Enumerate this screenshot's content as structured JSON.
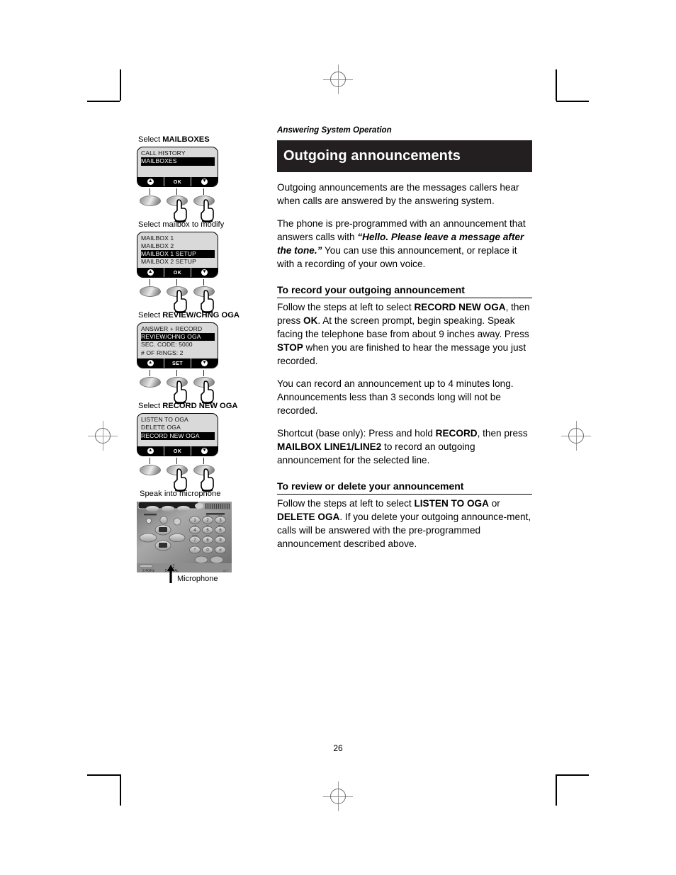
{
  "page": {
    "number": "26",
    "running_head": "Answering System Operation"
  },
  "banner": {
    "title": "Outgoing announcements"
  },
  "intro": [
    "Outgoing announcements are the messages callers hear when calls are answered by the answering system."
  ],
  "para2": {
    "before": "The phone is pre-programmed with an announcement that answers calls with ",
    "quote": "“Hello. Please leave a message after the tone.”",
    "after": " You can use this announcement, or replace it with a recording of your own voice."
  },
  "section_record": {
    "heading": "To record your outgoing announcement",
    "p1": {
      "t1": "Follow the steps at left to select ",
      "b1": "RECORD NEW OGA",
      "t2": ", then press ",
      "b2": "OK",
      "t3": ". At the screen prompt, begin speaking. Speak facing the telephone base from about 9 inches away. Press ",
      "b3": "STOP",
      "t4": " when you are finished to hear the message you just recorded."
    },
    "p2": "You can record an announcement up to 4 minutes long. Announcements less than 3 seconds long will not be recorded.",
    "p3": {
      "t1": "Shortcut (base only): Press and hold ",
      "b1": "RECORD",
      "t2": ",  then press ",
      "b2": "MAILBOX LINE1/LINE2",
      "t3": " to record an outgoing announcement for the selected line."
    }
  },
  "section_review": {
    "heading": "To review or delete your announcement",
    "p1": {
      "t1": "Follow the steps at left to select ",
      "b1": "LISTEN TO OGA",
      "t2": " or ",
      "b2": "DELETE OGA",
      "t3": ". If you delete your outgoing announce-ment, calls will be answered with the pre-programmed announcement described above."
    }
  },
  "steps": [
    {
      "caption_plain": "Select ",
      "caption_bold": "MAILBOXES",
      "screen": {
        "lines": [
          {
            "text": "CALL HISTORY",
            "highlight": false
          },
          {
            "text": "MAILBOXES",
            "highlight": true
          }
        ],
        "blank_rows": 2,
        "softkeys": [
          "up-arrow",
          "OK",
          "down-arrow"
        ]
      }
    },
    {
      "caption_plain": "Select mailbox to modify",
      "caption_bold": "",
      "screen": {
        "lines": [
          {
            "text": "MAILBOX 1",
            "highlight": false
          },
          {
            "text": "MAILBOX 2",
            "highlight": false
          },
          {
            "text": "MAILBOX 1 SETUP",
            "highlight": true
          },
          {
            "text": "MAILBOX 2 SETUP",
            "highlight": false
          }
        ],
        "blank_rows": 0,
        "softkeys": [
          "up-arrow",
          "OK",
          "down-arrow"
        ]
      }
    },
    {
      "caption_plain": "Select ",
      "caption_bold": "REVIEW/CHNG OGA",
      "screen": {
        "lines": [
          {
            "text": "ANSWER + RECORD",
            "highlight": false
          },
          {
            "text": "REVIEW/CHNG OGA",
            "highlight": true
          },
          {
            "text": "SEC. CODE: 5000",
            "highlight": false
          },
          {
            "text": "# OF RINGS: 2",
            "highlight": false
          }
        ],
        "blank_rows": 0,
        "softkeys": [
          "up-arrow",
          "SET",
          "down-arrow"
        ]
      }
    },
    {
      "caption_plain": "Select ",
      "caption_bold": "RECORD NEW OGA",
      "screen": {
        "lines": [
          {
            "text": "LISTEN TO OGA",
            "highlight": false
          },
          {
            "text": "DELETE OGA",
            "highlight": false
          },
          {
            "text": "RECORD NEW OGA",
            "highlight": true
          }
        ],
        "blank_rows": 1,
        "softkeys": [
          "up-arrow",
          "OK",
          "down-arrow"
        ]
      }
    }
  ],
  "final_step": {
    "caption": "Speak into microphone",
    "microphone_label": "Microphone"
  },
  "keypad": {
    "digits": [
      "1",
      "2",
      "3",
      "4",
      "5",
      "6",
      "7",
      "8",
      "9",
      "*",
      "0",
      "#"
    ]
  },
  "colors": {
    "banner_bg": "#231f20",
    "lcd_bg": "#d9d9d9",
    "highlight_bg": "#000000",
    "page_bg": "#ffffff"
  }
}
